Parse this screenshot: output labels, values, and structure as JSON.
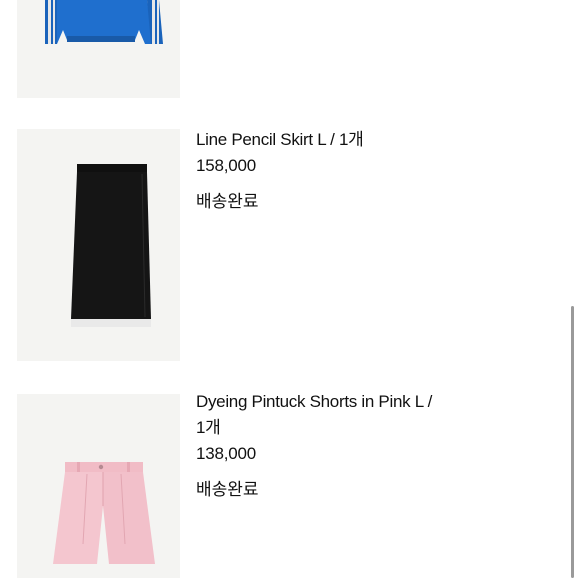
{
  "orders": [
    {
      "image": "blue-knit-sweater",
      "name": "",
      "price": "",
      "status": ""
    },
    {
      "image": "black-pencil-skirt",
      "name": "Line Pencil Skirt L / 1개",
      "price": "158,000",
      "status": "배송완료"
    },
    {
      "image": "pink-pintuck-shorts",
      "name_line1": "Dyeing Pintuck Shorts in Pink L /",
      "name_line2": "1개",
      "price": "138,000",
      "status": "배송완료"
    }
  ],
  "colors": {
    "sweater_blue": "#1f6fce",
    "skirt_black": "#141414",
    "shorts_pink": "#f4c6cf",
    "thumb_bg": "#f4f4f2"
  }
}
